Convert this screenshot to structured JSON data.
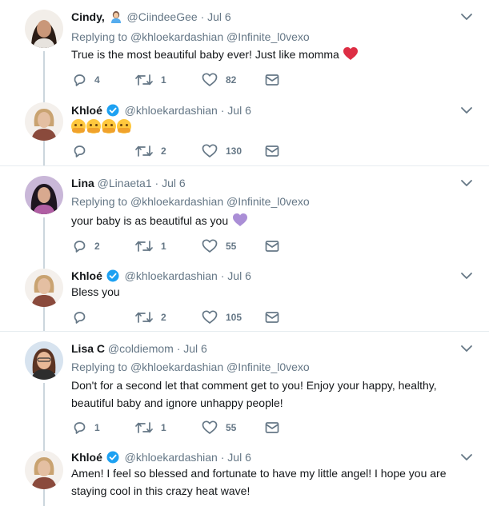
{
  "tweets": [
    {
      "name": "Cindy,",
      "name_emoji": "woman-icon",
      "handle": "@CiindeeGee",
      "dot": "·",
      "date": "Jul 6",
      "replying_prefix": "Replying to",
      "replying_to": [
        "@khloekardashian",
        "@Infinite_l0vexo"
      ],
      "text": "True is the most beautiful baby ever! Just like momma",
      "reply_count": "4",
      "retweet_count": "1",
      "like_count": "82"
    },
    {
      "name": "Khloé",
      "verified": true,
      "handle": "@khloekardashian",
      "dot": "·",
      "date": "Jul 6",
      "text": "",
      "text_emoji": "hugging-face-icon x4",
      "reply_count": "",
      "retweet_count": "2",
      "like_count": "130"
    },
    {
      "name": "Lina",
      "handle": "@Linaeta1",
      "dot": "·",
      "date": "Jul 6",
      "replying_prefix": "Replying to",
      "replying_to": [
        "@khloekardashian",
        "@Infinite_l0vexo"
      ],
      "text": "your baby is as beautiful as you",
      "reply_count": "2",
      "retweet_count": "1",
      "like_count": "55"
    },
    {
      "name": "Khloé",
      "verified": true,
      "handle": "@khloekardashian",
      "dot": "·",
      "date": "Jul 6",
      "text": "Bless you",
      "reply_count": "",
      "retweet_count": "2",
      "like_count": "105"
    },
    {
      "name": "Lisa C",
      "handle": "@coldiemom",
      "dot": "·",
      "date": "Jul 6",
      "replying_prefix": "Replying to",
      "replying_to": [
        "@khloekardashian",
        "@Infinite_l0vexo"
      ],
      "text": "Don't for a second let that comment get to you! Enjoy your happy, healthy, beautiful baby and ignore unhappy people!",
      "reply_count": "1",
      "retweet_count": "1",
      "like_count": "55"
    },
    {
      "name": "Khloé",
      "verified": true,
      "handle": "@khloekardashian",
      "dot": "·",
      "date": "Jul 6",
      "text": "Amen! I feel so blessed and fortunate to have my little angel! I hope you are staying cool in this crazy heat wave!"
    }
  ],
  "colors": {
    "text": "#14171a",
    "secondary": "#657786",
    "verified": "#1da1f2",
    "separator": "#e6ecf0",
    "thread_line": "#ccd6dd",
    "heart_emoji": "#dd2e44",
    "purple_heart_emoji": "#aa8ed6"
  }
}
